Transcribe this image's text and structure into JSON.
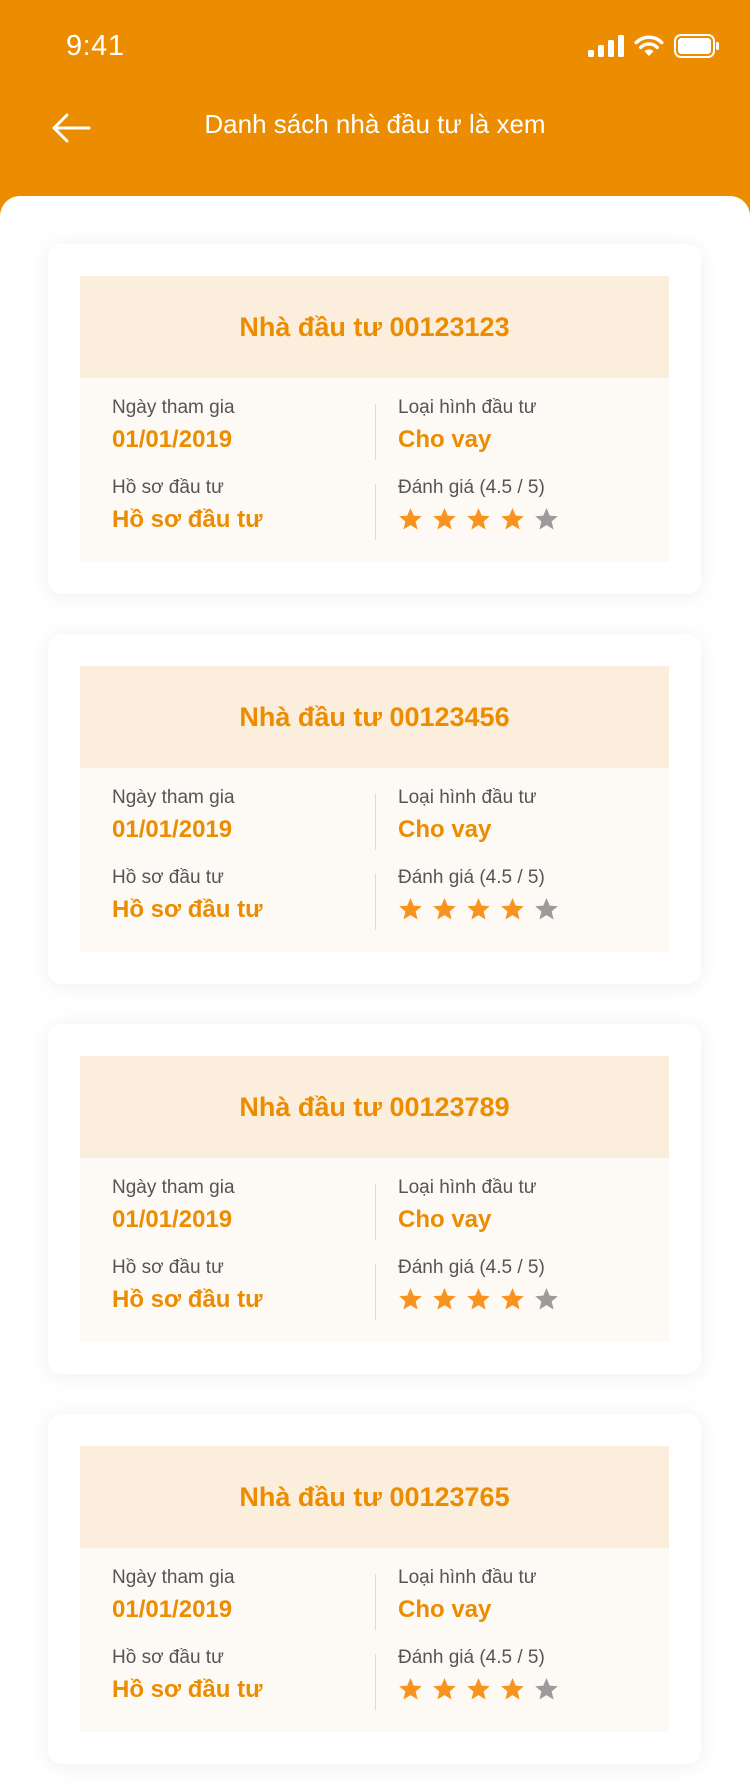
{
  "status_bar": {
    "time": "9:41",
    "icons": [
      "cellular-signal-icon",
      "wifi-icon",
      "battery-icon"
    ]
  },
  "header": {
    "title": "Danh sách nhà đầu tư là xem",
    "back_icon": "back-arrow-icon"
  },
  "colors": {
    "accent": "#EC8C00",
    "card_header_bg": "#FCEEDC",
    "card_body_bg": "#FDFAF5",
    "star_filled": "#F7931E",
    "star_empty": "#9B9B9B"
  },
  "investors": [
    {
      "name": "Nhà đầu tư 00123123",
      "join_label": "Ngày tham gia",
      "join_date": "01/01/2019",
      "type_label": "Loại hình đầu tư",
      "type_value": "Cho vay",
      "profile_label": "Hồ sơ đầu tư",
      "profile_value": "Hồ sơ đầu tư",
      "rating_label": "Đánh giá (4.5 / 5)",
      "stars_filled": 4,
      "stars_total": 5
    },
    {
      "name": "Nhà đầu tư 00123456",
      "join_label": "Ngày tham gia",
      "join_date": "01/01/2019",
      "type_label": "Loại hình đầu tư",
      "type_value": "Cho vay",
      "profile_label": "Hồ sơ đầu tư",
      "profile_value": "Hồ sơ đầu tư",
      "rating_label": "Đánh giá (4.5 / 5)",
      "stars_filled": 4,
      "stars_total": 5
    },
    {
      "name": "Nhà đầu tư 00123789",
      "join_label": "Ngày tham gia",
      "join_date": "01/01/2019",
      "type_label": "Loại hình đầu tư",
      "type_value": "Cho vay",
      "profile_label": "Hồ sơ đầu tư",
      "profile_value": "Hồ sơ đầu tư",
      "rating_label": "Đánh giá (4.5 / 5)",
      "stars_filled": 4,
      "stars_total": 5
    },
    {
      "name": "Nhà đầu tư 00123765",
      "join_label": "Ngày tham gia",
      "join_date": "01/01/2019",
      "type_label": "Loại hình đầu tư",
      "type_value": "Cho vay",
      "profile_label": "Hồ sơ đầu tư",
      "profile_value": "Hồ sơ đầu tư",
      "rating_label": "Đánh giá (4.5 / 5)",
      "stars_filled": 4,
      "stars_total": 5
    }
  ]
}
